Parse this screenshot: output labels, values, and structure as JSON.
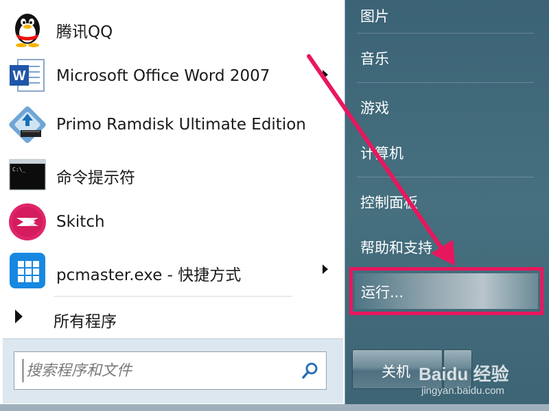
{
  "pinned_programs": [
    {
      "label": "腾讯QQ",
      "icon": "qq-penguin-icon",
      "has_submenu": false
    },
    {
      "label": "Microsoft Office Word 2007",
      "icon": "word-icon",
      "has_submenu": true
    },
    {
      "label": "Primo Ramdisk Ultimate Edition",
      "icon": "ramdisk-icon",
      "has_submenu": false
    },
    {
      "label": "命令提示符",
      "icon": "command-prompt-icon",
      "has_submenu": false
    },
    {
      "label": "Skitch",
      "icon": "skitch-icon",
      "has_submenu": false
    },
    {
      "label": "pcmaster.exe - 快捷方式",
      "icon": "pcmaster-icon",
      "has_submenu": true
    }
  ],
  "all_programs_label": "所有程序",
  "search": {
    "placeholder": "搜索程序和文件"
  },
  "right_menu": [
    {
      "label": "图片"
    },
    {
      "label": "音乐"
    },
    {
      "label": "游戏"
    },
    {
      "label": "计算机"
    },
    {
      "label": "控制面板"
    },
    {
      "label": "帮助和支持"
    }
  ],
  "run_label": "运行...",
  "shutdown_label": "关机",
  "watermark": {
    "logo": "Baidu 经验",
    "url": "jingyan.baidu.com"
  },
  "colors": {
    "highlight_box": "#e8175d",
    "arrow": "#e8175d",
    "right_panel": "#416a7b"
  }
}
